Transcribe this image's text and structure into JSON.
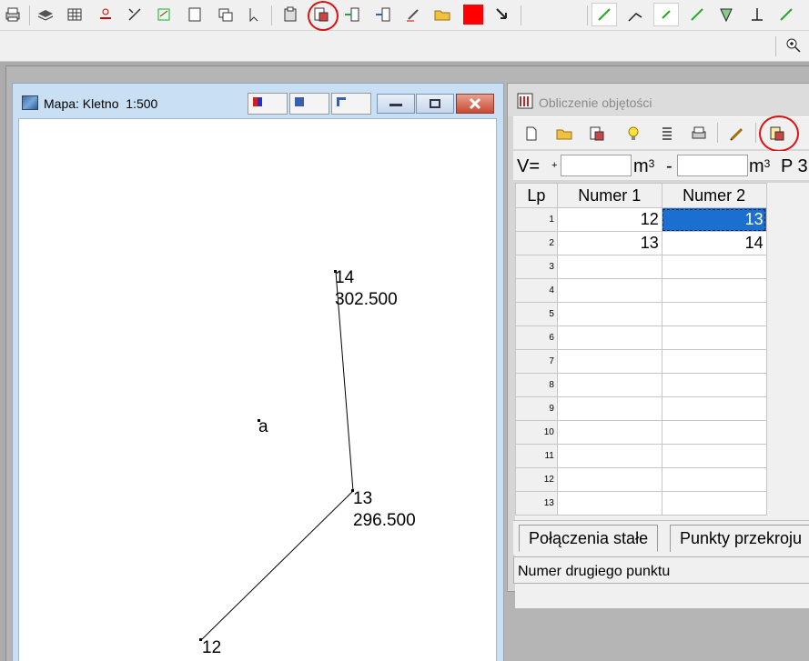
{
  "map_window": {
    "title": "Mapa: Kletno  1:500",
    "points": [
      {
        "id": "14",
        "height": "302.500"
      },
      {
        "id": "a"
      },
      {
        "id": "13",
        "height": "296.500"
      },
      {
        "id": "12"
      }
    ]
  },
  "calc_window": {
    "title": "Obliczenie objętości",
    "volume": {
      "label": "V=",
      "plus": "+",
      "value_plus": "",
      "unit": "m",
      "unit_exp": "3",
      "minus": "-",
      "value_minus": "",
      "p_label": "P 3"
    },
    "grid": {
      "headers": [
        "Lp",
        "Numer 1",
        "Numer 2"
      ],
      "rows": [
        {
          "lp": "1",
          "n1": "12",
          "n2": "13",
          "selected": true
        },
        {
          "lp": "2",
          "n1": "13",
          "n2": "14"
        },
        {
          "lp": "3",
          "n1": "",
          "n2": ""
        },
        {
          "lp": "4",
          "n1": "",
          "n2": ""
        },
        {
          "lp": "5",
          "n1": "",
          "n2": ""
        },
        {
          "lp": "6",
          "n1": "",
          "n2": ""
        },
        {
          "lp": "7",
          "n1": "",
          "n2": ""
        },
        {
          "lp": "8",
          "n1": "",
          "n2": ""
        },
        {
          "lp": "9",
          "n1": "",
          "n2": ""
        },
        {
          "lp": "10",
          "n1": "",
          "n2": ""
        },
        {
          "lp": "11",
          "n1": "",
          "n2": ""
        },
        {
          "lp": "12",
          "n1": "",
          "n2": ""
        },
        {
          "lp": "13",
          "n1": "",
          "n2": ""
        }
      ]
    },
    "tabs": [
      "Połączenia stałe",
      "Punkty przekroju"
    ],
    "status": "Numer drugiego punktu"
  },
  "colors": {
    "selection": "#1a6fd1",
    "highlight_circle": "#e01010",
    "red_swatch": "#ff0000"
  }
}
